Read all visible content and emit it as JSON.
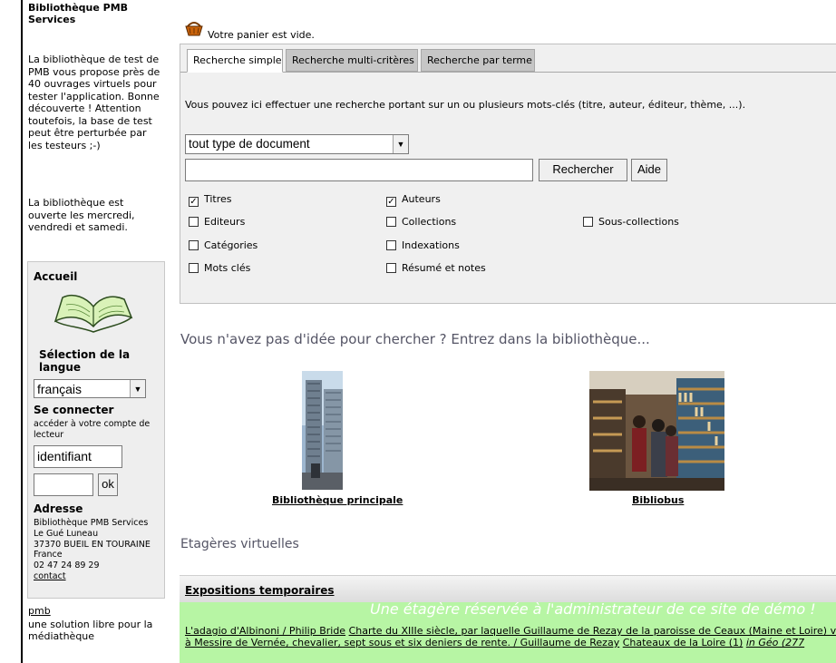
{
  "left": {
    "library_title": "Bibliothèque PMB Services",
    "description": "La bibliothèque de test de PMB vous propose près de 40 ouvrages virtuels pour tester l'application. Bonne découverte ! Attention toutefois, la base de test peut être perturbée par les testeurs ;-)",
    "opening": "La bibliothèque est ouverte les mercredi, vendredi et samedi.",
    "box": {
      "accueil": "Accueil",
      "language_title": "Sélection de la langue",
      "language_value": "français",
      "connect_title": "Se connecter",
      "connect_desc": "accéder à votre compte de lecteur",
      "login_value": "identifiant",
      "password_value": "",
      "ok_label": "ok",
      "address_title": "Adresse",
      "address_lines": [
        "Bibliothèque PMB Services",
        "Le Gué Luneau",
        "37370 BUEIL EN TOURAINE",
        "France",
        "02 47 24 89 29"
      ],
      "contact_link": "contact"
    },
    "pmb_link": "pmb",
    "pmb_desc": "une solution libre pour la médiathèque"
  },
  "main": {
    "cart_text": "Votre panier est vide.",
    "tabs": [
      "Recherche simple",
      "Recherche multi-critères",
      "Recherche par terme"
    ],
    "intro": "Vous pouvez ici effectuer une recherche portant sur un ou plusieurs mots-clés (titre, auteur, éditeur, thème, ...).",
    "doc_type": "tout type de document",
    "search_value": "",
    "search_button": "Rechercher",
    "help_button": "Aide",
    "checkboxes": [
      {
        "label": "Titres",
        "checked": true
      },
      {
        "label": "Auteurs",
        "checked": true
      },
      {
        "label": "Editeurs",
        "checked": false
      },
      {
        "label": "Collections",
        "checked": false
      },
      {
        "label": "Sous-collections",
        "checked": false
      },
      {
        "label": "Catégories",
        "checked": false
      },
      {
        "label": "Indexations",
        "checked": false
      },
      {
        "label": "Mots clés",
        "checked": false
      },
      {
        "label": "Résumé et notes",
        "checked": false
      }
    ],
    "enter_title": "Vous n'avez pas d'idée pour chercher ? Entrez dans la bibliothèque...",
    "locations": [
      "Bibliothèque principale",
      "Bibliobus"
    ],
    "shelves_title": "Etagères virtuelles",
    "expo": {
      "title": "Expositions temporaires",
      "banner": "Une étagère réservée à l'administrateur de ce site de démo !",
      "line1_links": [
        "L'adagio d'Albinoni / Philip Bride",
        "Charte du XIIIe siècle, par laquelle Guillaume de Rezay de la paroisse de Ceaux (Maine et Loire) vend"
      ],
      "line2_link": "à Messire de Vernée, chevalier, sept sous et six deniers de rente. / Guillaume de Rezay",
      "line2_link2": "Chateaux de la Loire (1)",
      "line2_italic": "in Géo (277"
    }
  },
  "colors": {
    "panel_bg": "#f0f0f0",
    "tab_inactive": "#c6c6c6",
    "expo_bg": "#b7f5a4",
    "heading_text": "#555566"
  }
}
